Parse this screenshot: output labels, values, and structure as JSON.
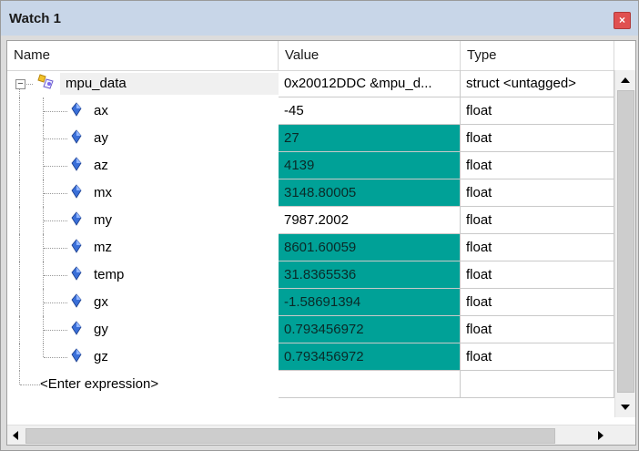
{
  "window": {
    "title": "Watch 1",
    "close_glyph": "×"
  },
  "columns": {
    "name": "Name",
    "value": "Value",
    "type": "Type"
  },
  "root": {
    "name": "mpu_data",
    "value": "0x20012DDC &mpu_d...",
    "type": "struct <untagged>",
    "icon": "struct-icon",
    "expanded": true
  },
  "children": [
    {
      "name": "ax",
      "value": "-45",
      "type": "float",
      "changed": false
    },
    {
      "name": "ay",
      "value": "27",
      "type": "float",
      "changed": true
    },
    {
      "name": "az",
      "value": "4139",
      "type": "float",
      "changed": true
    },
    {
      "name": "mx",
      "value": "3148.80005",
      "type": "float",
      "changed": true
    },
    {
      "name": "my",
      "value": "7987.2002",
      "type": "float",
      "changed": false
    },
    {
      "name": "mz",
      "value": "8601.60059",
      "type": "float",
      "changed": true
    },
    {
      "name": "temp",
      "value": "31.8365536",
      "type": "float",
      "changed": true
    },
    {
      "name": "gx",
      "value": "-1.58691394",
      "type": "float",
      "changed": true
    },
    {
      "name": "gy",
      "value": "0.793456972",
      "type": "float",
      "changed": true
    },
    {
      "name": "gz",
      "value": "0.793456972",
      "type": "float",
      "changed": true
    }
  ],
  "enter_expression": "<Enter expression>",
  "colors": {
    "changed_value_bg": "#00A197",
    "title_bar": "#C8D6E8",
    "close_button": "#E05050"
  }
}
